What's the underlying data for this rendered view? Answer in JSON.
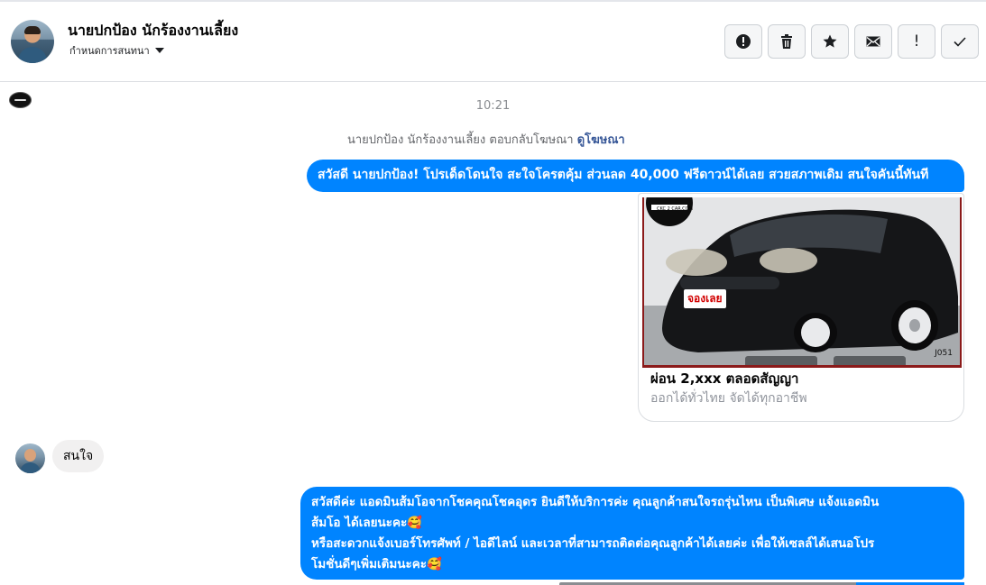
{
  "header": {
    "contact_name": "นายปกป้อง นักร้องงานเลี้ยง",
    "subtitle": "กำหนดการสนทนา",
    "actions": [
      {
        "name": "report-icon",
        "label": "!"
      },
      {
        "name": "trash-icon",
        "label": ""
      },
      {
        "name": "star-icon",
        "label": ""
      },
      {
        "name": "envelope-icon",
        "label": ""
      },
      {
        "name": "spam-icon",
        "label": "!"
      },
      {
        "name": "check-icon",
        "label": "✓"
      }
    ]
  },
  "chat": {
    "timestamp": "10:21",
    "ad_reply_text": "นายปกป้อง นักร้องงานเลี้ยง ตอบกลับโฆษณา",
    "ad_reply_link": "ดูโฆษณา",
    "messages": [
      {
        "side": "out",
        "text": "สวัสดี นายปกป้อง! โปรเด็ดโดนใจ สะใจโครตคุ้ม ส่วนลด 40,000 ฟรีดาวน์ได้เลย สวยสภาพเดิม สนใจคันนี้ทันที"
      },
      {
        "side": "in",
        "text": "สนใจ"
      },
      {
        "side": "out",
        "lines": [
          "สวัสดีค่ะ แอดมินส้มโอจากโชคคุณโชคอุดร ยินดีให้บริการค่ะ   คุณลูกค้าสนใจรถรุ่นไหน เป็นพิเศษ แจ้งแอดมิน",
          "ส้มโอ ได้เลยนะคะ🥰",
          "หรือสะดวกแจ้งเบอร์โทรศัพท์ / ไอดีไลน์ และเวลาที่สามารถติดต่อคุณลูกค้าได้เลยค่ะ เพื่อให้เซลล์ได้เสนอโปร",
          "โมชั่นดีๆเพิ่มเติมนะคะ🥰"
        ]
      }
    ],
    "ad_card": {
      "image_badge": "จองเลย",
      "image_logo": "CKC 2 CAR.COM",
      "image_code": "J051",
      "title": "ผ่อน 2,xxx ตลอดสัญญา",
      "description": "ออกได้ทั่วไทย จัดได้ทุกอาชีพ"
    }
  },
  "colors": {
    "accent": "#0084ff",
    "incoming_bubble": "#f1f0f0",
    "muted_text": "#65676b",
    "link": "#385898"
  }
}
